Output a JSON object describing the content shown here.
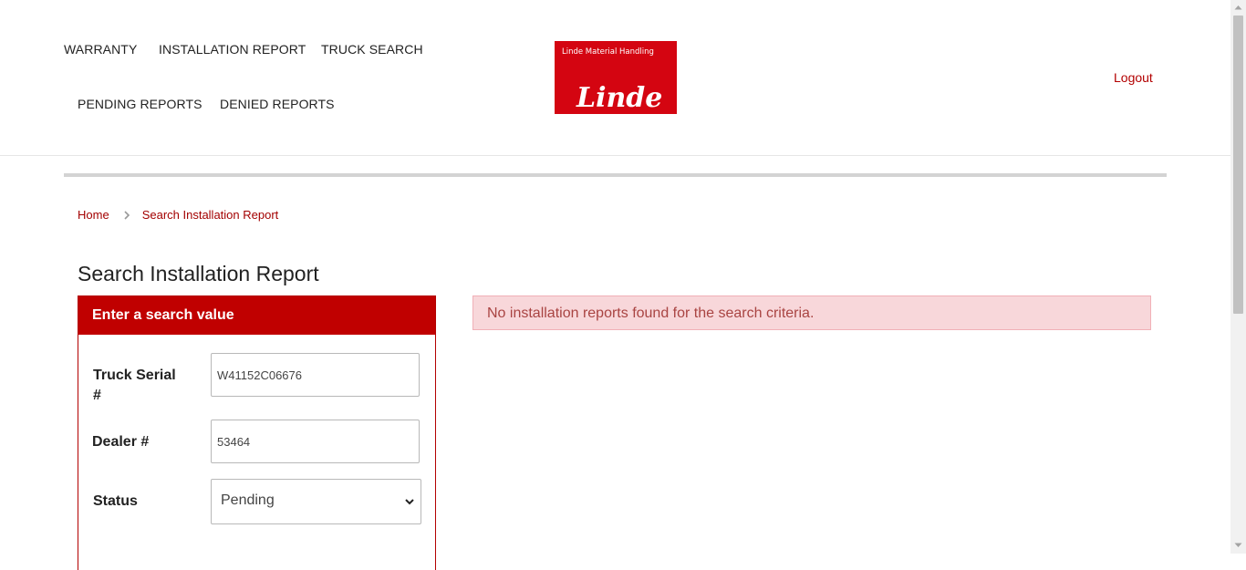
{
  "nav": {
    "warranty": "WARRANTY",
    "installation_report": "INSTALLATION REPORT",
    "truck_search": "TRUCK SEARCH",
    "pending_reports": "PENDING REPORTS",
    "denied_reports": "DENIED REPORTS"
  },
  "logo": {
    "tagline": "Linde Material Handling",
    "wordmark": "Linde",
    "color": "#d40511"
  },
  "logout": "Logout",
  "breadcrumb": {
    "home": "Home",
    "current": "Search Installation Report",
    "separator_icon": "chevron-right-icon"
  },
  "page_title": "Search Installation Report",
  "search_panel": {
    "header": "Enter a search value",
    "header_color": "#c00000",
    "truck_serial": {
      "label": "Truck Serial #",
      "value": "W41152C06676"
    },
    "dealer": {
      "label": "Dealer #",
      "value": "53464"
    },
    "status": {
      "label": "Status",
      "selected": "Pending"
    }
  },
  "alert": {
    "message": "No installation reports found for the search criteria.",
    "background": "#f8d7da",
    "text_color": "#a94442"
  },
  "colors": {
    "accent": "#b30000"
  }
}
